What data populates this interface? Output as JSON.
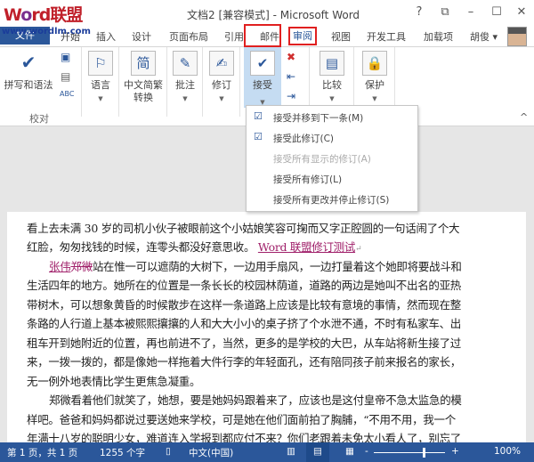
{
  "watermark": {
    "logo": "Word联盟",
    "url": "www.wordlm.com"
  },
  "window": {
    "title": "文档2 [兼容模式] - Microsoft Word",
    "help": "?",
    "restore": "⧉",
    "minimize": "–",
    "maximize": "☐",
    "close": "✕"
  },
  "tabs": {
    "file": "文件",
    "items": [
      "开始",
      "插入",
      "设计",
      "页面布局",
      "引用",
      "邮件",
      "审阅",
      "视图",
      "开发工具",
      "加载项"
    ],
    "user": "胡俊 ▾",
    "active": "审阅"
  },
  "ribbon": {
    "spelling": "拼写和语法",
    "proofing_group": "校对",
    "language": "语言",
    "chinese_conv": "中文简繁",
    "chinese_conv2": "转换",
    "comment": "批注",
    "track": "修订",
    "accept": "接受",
    "compare": "比较",
    "protect": "保护",
    "collapse": "^"
  },
  "menu": {
    "items": [
      {
        "label": "接受并移到下一条(M)",
        "enabled": true,
        "icon": "accept-doc-icon"
      },
      {
        "label": "接受此修订(C)",
        "enabled": true,
        "icon": "accept-doc-icon"
      },
      {
        "label": "接受所有显示的修订(A)",
        "enabled": false
      },
      {
        "label": "接受所有修订(L)",
        "enabled": true
      },
      {
        "label": "接受所有更改并停止修订(S)",
        "enabled": true
      }
    ]
  },
  "document": {
    "lines": [
      "看上去未满 30 岁的司机小伙子被眼前这个小姑娘笑容可掬而又字正腔圆的一句话闹了个大",
      "红脸，匆匆找钱的时候，连零头都没好意思收。",
      "站在惟一可以遮荫的大树下，一边用手扇风，一边打量着这个她即将要战斗和",
      "生活四年的地方。她所在的位置是一条长长的校园林荫道，道路的两边是她叫不出名的亚热",
      "带树木，可以想象黄昏的时候散步在这样一条道路上应该是比较有意境的事情，然而现在整",
      "条路的人行道上基本被熙熙攘攘的人和大大小小的桌子挤了个水泄不通，不时有私家车、出",
      "租车开到她附近的位置，再也前进不了，当然，更多的是学校的大巴，从车站将新生接了过",
      "来，一拨一拨的，都是像她一样拖着大件行李的年轻面孔，还有陪同孩子前来报名的家长，",
      "无一例外地表情比学生更焦急凝重。",
      "郑微看着他们就笑了，她想，要是她妈妈跟着来了，应该也是这付皇帝不急太监急的模",
      "样吧。爸爸和妈妈都说过要送她来学校，可是她在他们面前拍了胸脯，“不用不用，我一个",
      "年满十八岁的聪明少女，难道连入学报到都应付不来？你们老跟着未免太小看人了，别忘了"
    ],
    "inserted_text": "Word 联盟修订测试",
    "inserted_name": "张伟",
    "deleted_name": "郑微",
    "para_mark": "↵"
  },
  "status": {
    "page": "第 1 页，共 1 页",
    "words": "1255 个字",
    "language": "中文(中国)",
    "zoom_minus": "-",
    "zoom_plus": "+",
    "zoom": "100%"
  },
  "zoom_level_percent": 100,
  "colors": {
    "accent": "#2b579a",
    "revision": "#a0206a",
    "highlight": "#e02020"
  }
}
